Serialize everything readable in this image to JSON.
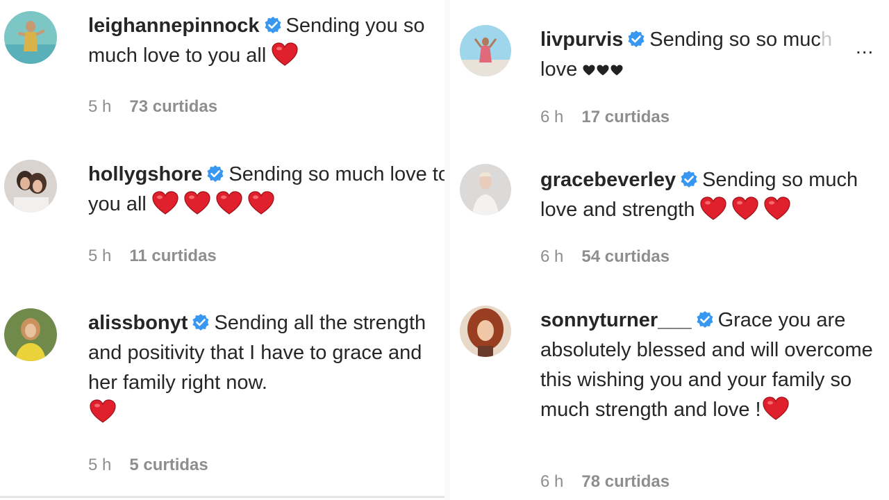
{
  "colors": {
    "heart": "#e0202c",
    "verified": "#3897f0",
    "meta_text": "#8e8e8e"
  },
  "comments": [
    {
      "username": "leighannepinnock",
      "text": "Sending you so much love to you all",
      "reaction": "red heart x1",
      "time": "5 h",
      "likes": "73 curtidas"
    },
    {
      "username": "hollygshore",
      "text": "Sending so much love to you all",
      "reaction": "red heart x4",
      "time": "5 h",
      "likes": "11 curtidas"
    },
    {
      "username": "alissbonyt",
      "text": "Sending all the strength and positivity that I have to grace and her family right now.",
      "reaction": "red heart x1",
      "time": "5 h",
      "likes": "5 curtidas"
    },
    {
      "username": "livpurvis",
      "text_a": "Sending so so muc",
      "text_b": "h",
      "text_c": "love",
      "reaction": "black heart x3",
      "more": "...",
      "time": "6 h",
      "likes": "17 curtidas"
    },
    {
      "username": "gracebeverley",
      "text": "Sending so much love and strength",
      "reaction": "red heart x3",
      "time": "6 h",
      "likes": "54 curtidas"
    },
    {
      "username": "sonnyturner___",
      "text": "Grace you are absolutely blessed and will overcome this wishing you and your family so much strength and love !",
      "reaction": "red heart x1",
      "time": "6 h",
      "likes": "78 curtidas"
    }
  ]
}
